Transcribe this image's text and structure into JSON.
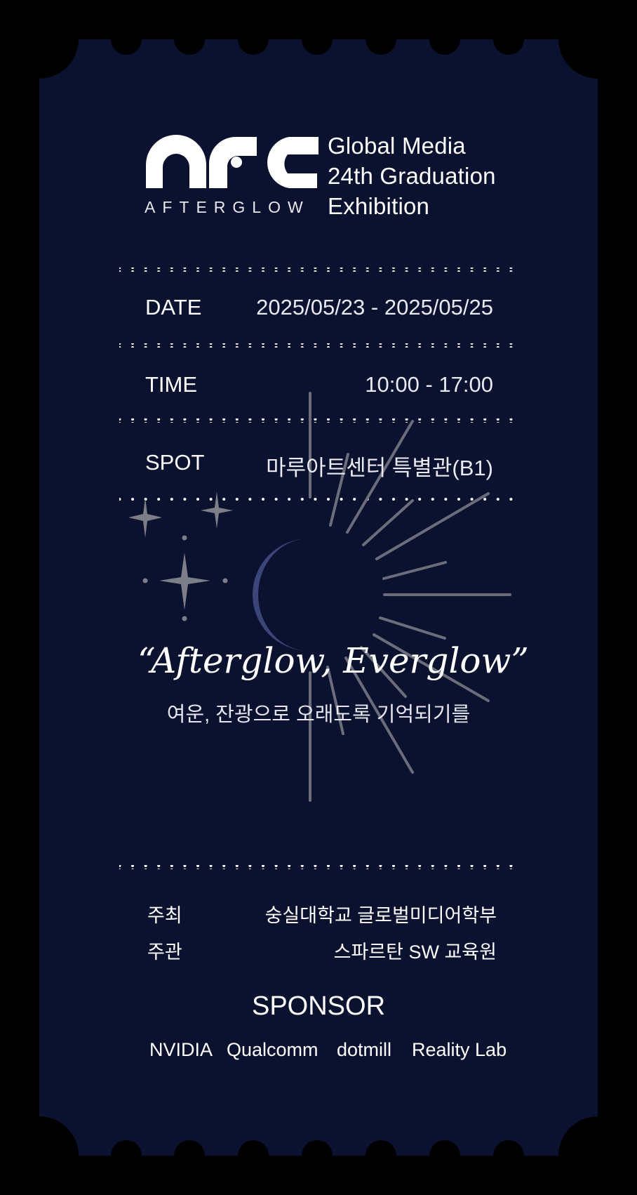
{
  "logo": {
    "mark": "AFG",
    "subtitle": "AFTERGLOW",
    "lines": [
      "Global Media",
      "24th Graduation",
      "Exhibition"
    ]
  },
  "details": [
    {
      "label": "DATE",
      "value": "2025/05/23 - 2025/05/25"
    },
    {
      "label": "TIME",
      "value": "10:00 - 17:00"
    },
    {
      "label": "SPOT",
      "value": "마루아트센터 특별관(B1)"
    }
  ],
  "quote": {
    "open": "“",
    "text": "Afterglow, Everglow",
    "close": "”",
    "subtitle": "여운, 잔광으로 오래도록 기억되기를"
  },
  "organizers": [
    {
      "label": "주최",
      "value": "숭실대학교 글로벌미디어학부"
    },
    {
      "label": "주관",
      "value": "스파르탄 SW 교육원"
    }
  ],
  "sponsor": {
    "title": "SPONSOR",
    "items": [
      "NVIDIA",
      "Qualcomm",
      "dotmill",
      "Reality Lab"
    ]
  },
  "colors": {
    "background": "#000000",
    "ticket": "#0b1230",
    "moon": "#3b4578",
    "rays": "#6b6e7a",
    "text": "#ffffff"
  },
  "icons": [
    "afg-logo-icon",
    "moon-icon",
    "sparkle-star-icon",
    "sun-ray-icon"
  ]
}
